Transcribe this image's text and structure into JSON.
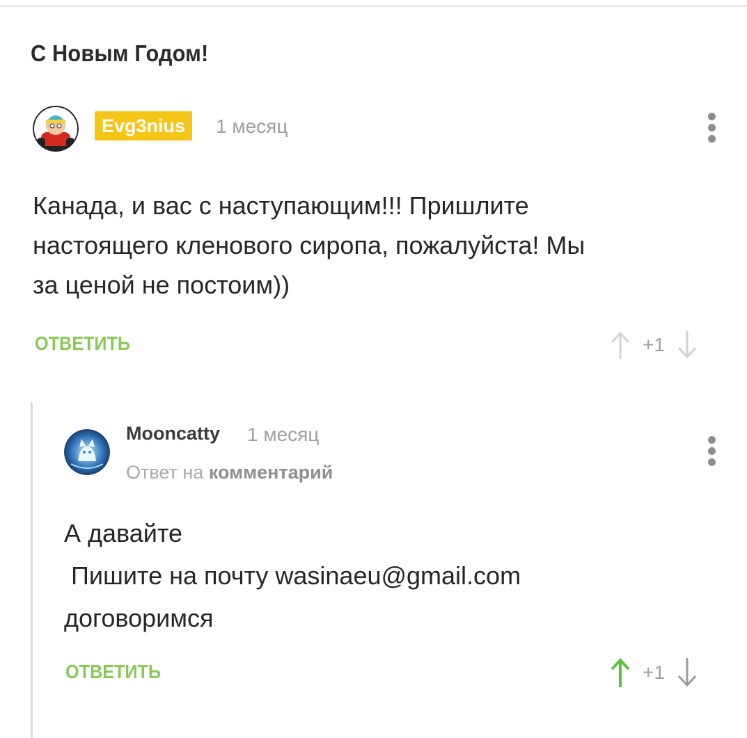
{
  "post": {
    "title": "С Новым Годом!"
  },
  "comments": [
    {
      "author": "Evg3nius",
      "author_badge_color": "#f5c518",
      "time": "1 месяц",
      "text": "Канада, и вас с наступающим!!! Пришлите\nнастоящего кленового сиропа, пожалуйста! Мы\nза ценой не постоим))",
      "reply_label": "ОТВЕТИТЬ",
      "rating": "+1",
      "upvoted": false
    },
    {
      "author": "Mooncatty",
      "time": "1 месяц",
      "reply_prefix": "Ответ на",
      "reply_target": "комментарий",
      "text": "А давайте\n Пишите на почту wasinaeu@gmail.com\nдоговоримся",
      "reply_label": "ОТВЕТИТЬ",
      "rating": "+1",
      "upvoted": true
    }
  ],
  "colors": {
    "accent_green": "#8ac858",
    "badge_yellow": "#f5c518",
    "muted": "#a0a0a0"
  },
  "icons": {
    "more": "more-vertical-icon",
    "up": "arrow-up-icon",
    "down": "arrow-down-icon"
  }
}
